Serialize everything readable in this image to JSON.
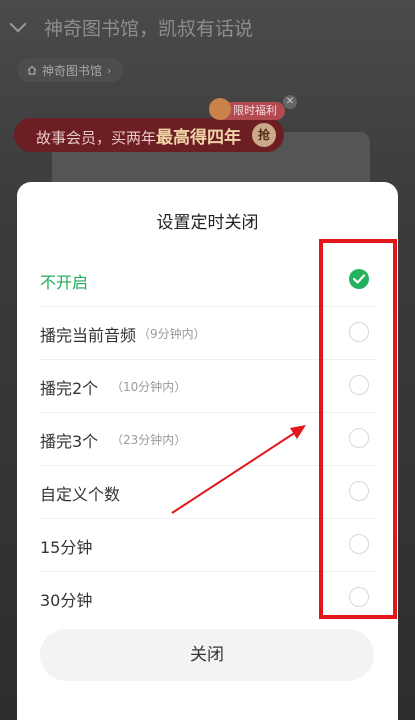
{
  "background": {
    "header_title": "神奇图书馆，凯叔有话说",
    "album_chip_label": "神奇图书馆",
    "promo": {
      "badge_label": "限时福利",
      "text_prefix": "故事会员，买两年",
      "text_highlight": "最高得四年",
      "grab_label": "抢"
    }
  },
  "sheet": {
    "title": "设置定时关闭",
    "options": [
      {
        "label": "不开启",
        "note": "",
        "selected": true
      },
      {
        "label": "播完当前音频",
        "note": "（9分钟内）",
        "selected": false
      },
      {
        "label": "播完2个",
        "note": "（10分钟内）",
        "selected": false
      },
      {
        "label": "播完3个",
        "note": "（23分钟内）",
        "selected": false
      },
      {
        "label": "自定义个数",
        "note": "",
        "selected": false
      },
      {
        "label": "15分钟",
        "note": "",
        "selected": false
      },
      {
        "label": "30分钟",
        "note": "",
        "selected": false
      }
    ],
    "close_label": "关闭"
  },
  "colors": {
    "accent_green": "#23b15e",
    "annotation_red": "#e3161c"
  },
  "icons": {
    "back": "chevron-down-icon",
    "home": "home-icon",
    "check": "check-icon"
  }
}
